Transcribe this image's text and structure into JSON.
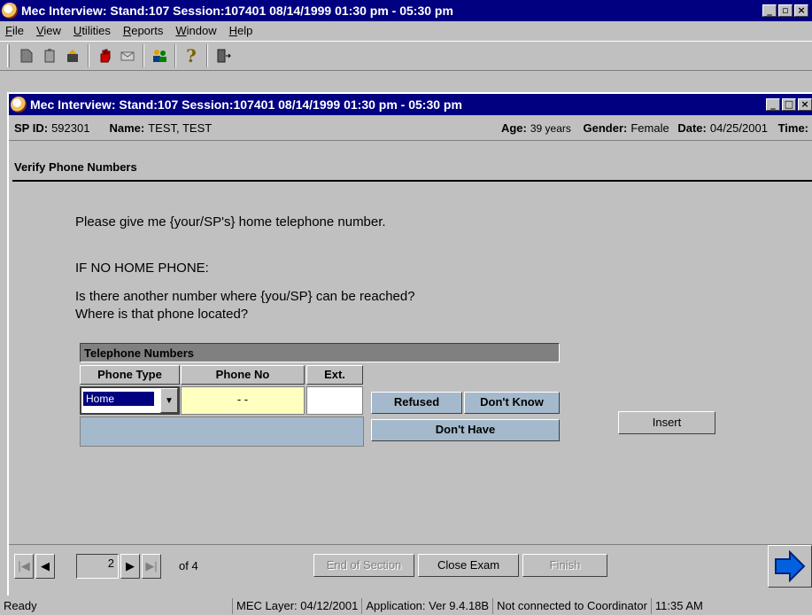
{
  "app": {
    "title": "Mec Interview: Stand:107 Session:107401 08/14/1999 01:30 pm - 05:30 pm",
    "menu": [
      "File",
      "View",
      "Utilities",
      "Reports",
      "Window",
      "Help"
    ]
  },
  "toolbar_icons": [
    "new-icon",
    "clipboard-icon",
    "open-icon",
    "stop-hand-icon",
    "mail-icon",
    "people-icon",
    "help-icon",
    "exit-door-icon"
  ],
  "child_window": {
    "title": "Mec Interview: Stand:107 Session:107401 08/14/1999 01:30 pm - 05:30 pm"
  },
  "info": {
    "sp_id_label": "SP ID:",
    "sp_id": "592301",
    "name_label": "Name:",
    "name": "TEST, TEST",
    "age_label": "Age:",
    "age": "39 years",
    "gender_label": "Gender:",
    "gender": "Female",
    "date_label": "Date:",
    "date": "04/25/2001",
    "time_label": "Time:"
  },
  "section_title": "Verify Phone Numbers",
  "question": {
    "line1": "Please give me {your/SP's} home telephone number.",
    "line2": "IF NO HOME PHONE:",
    "line3": "Is there another number where {you/SP} can be reached?",
    "line4": "Where is that phone located?"
  },
  "grid": {
    "title": "Telephone Numbers",
    "columns": [
      "Phone Type",
      "Phone No",
      "Ext."
    ],
    "row": {
      "phone_type": "Home",
      "phone_no": "- -",
      "ext": ""
    }
  },
  "buttons": {
    "refused": "Refused",
    "dont_know": "Don't Know",
    "dont_have": "Don't Have",
    "insert": "Insert",
    "end_of_section": "End of Section",
    "close_exam": "Close Exam",
    "finish": "Finish"
  },
  "pager": {
    "current": "2",
    "of": "of 4"
  },
  "status": {
    "ready": "Ready",
    "mec_layer": "MEC Layer: 04/12/2001",
    "application": "Application: Ver 9.4.18B",
    "connection": "Not connected to Coordinator",
    "time": "11:35 AM"
  }
}
